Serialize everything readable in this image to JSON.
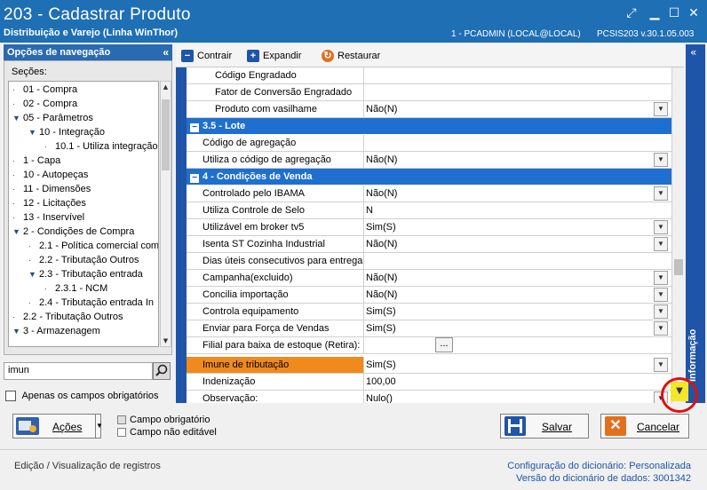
{
  "window": {
    "title": "203 - Cadastrar  Produto",
    "subtitle": "Distribuição e Varejo (Linha WinThor)",
    "user_info": "1 - PCADMIN (LOCAL@LOCAL)",
    "version_info": "PCSIS203  v.30.1.05.003"
  },
  "nav": {
    "header": "Opções de navegação",
    "sections_label": "Seções:",
    "items": [
      {
        "label": "01 - Compra",
        "level": 0,
        "toggle": ""
      },
      {
        "label": "02 - Compra",
        "level": 0,
        "toggle": ""
      },
      {
        "label": "05 - Parâmetros",
        "level": 0,
        "toggle": "v"
      },
      {
        "label": "10 - Integração",
        "level": 1,
        "toggle": "v"
      },
      {
        "label": "10.1 - Utiliza integração",
        "level": 2,
        "toggle": ""
      },
      {
        "label": "1 - Capa",
        "level": 0,
        "toggle": ""
      },
      {
        "label": "10 - Autopeças",
        "level": 0,
        "toggle": ""
      },
      {
        "label": "11 - Dimensões",
        "level": 0,
        "toggle": ""
      },
      {
        "label": "12 - Licitações",
        "level": 0,
        "toggle": ""
      },
      {
        "label": "13 - Inservível",
        "level": 0,
        "toggle": ""
      },
      {
        "label": "2 - Condições de Compra",
        "level": 0,
        "toggle": "v"
      },
      {
        "label": "2.1 - Política comercial com",
        "level": 1,
        "toggle": ""
      },
      {
        "label": "2.2 - Tributação Outros",
        "level": 1,
        "toggle": ""
      },
      {
        "label": "2.3 - Tributação entrada",
        "level": 1,
        "toggle": "v"
      },
      {
        "label": "2.3.1 - NCM",
        "level": 2,
        "toggle": ""
      },
      {
        "label": "2.4 - Tributação entrada In",
        "level": 1,
        "toggle": ""
      },
      {
        "label": "2.2 - Tributação Outros",
        "level": 0,
        "toggle": ""
      },
      {
        "label": "3 - Armazenagem",
        "level": 0,
        "toggle": "v"
      }
    ],
    "search_value": "imun",
    "only_required_label": "Apenas os campos obrigatórios"
  },
  "toolbar": {
    "collapse_label": "Contrair",
    "expand_label": "Expandir",
    "restore_label": "Restaurar"
  },
  "grid": {
    "rows": [
      {
        "kind": "field",
        "label": "Código Engradado",
        "value": "",
        "dropdown": false,
        "indent": true
      },
      {
        "kind": "field",
        "label": "Fator de Conversão Engradado",
        "value": "",
        "dropdown": false,
        "indent": true
      },
      {
        "kind": "field",
        "label": "Produto com vasilhame",
        "value": "Não(N)",
        "dropdown": true,
        "indent": true
      },
      {
        "kind": "section",
        "label": "3.5 - Lote"
      },
      {
        "kind": "field",
        "label": "Código de agregação",
        "value": "",
        "dropdown": false
      },
      {
        "kind": "field",
        "label": "Utiliza o código de agregação",
        "value": "Não(N)",
        "dropdown": true
      },
      {
        "kind": "section",
        "label": "4 - Condições de Venda"
      },
      {
        "kind": "field",
        "label": "Controlado pelo IBAMA",
        "value": "Não(N)",
        "dropdown": true
      },
      {
        "kind": "field",
        "label": "Utiliza Controle de Selo",
        "value": "N",
        "dropdown": false
      },
      {
        "kind": "field",
        "label": "Utilizável em broker tv5",
        "value": "Sim(S)",
        "dropdown": true
      },
      {
        "kind": "field",
        "label": "Isenta ST Cozinha Industrial",
        "value": "Não(N)",
        "dropdown": true
      },
      {
        "kind": "field",
        "label": "Dias úteis consecutivos para entrega",
        "value": "",
        "dropdown": false
      },
      {
        "kind": "field",
        "label": "Campanha(excluido)",
        "value": "Não(N)",
        "dropdown": true
      },
      {
        "kind": "field",
        "label": "Concilia importação",
        "value": "Não(N)",
        "dropdown": true
      },
      {
        "kind": "field",
        "label": "Controla equipamento",
        "value": "Sim(S)",
        "dropdown": true
      },
      {
        "kind": "field",
        "label": "Enviar para Força de Vendas",
        "value": "Sim(S)",
        "dropdown": true
      },
      {
        "kind": "field",
        "label": "Filial para baixa de estoque (Retira):",
        "value": "",
        "dropdown": false,
        "ellipsis": true
      },
      {
        "kind": "field",
        "label": "Imune de tributação",
        "value": "Sim(S)",
        "dropdown": true,
        "selected": true
      },
      {
        "kind": "field",
        "label": "Indenização",
        "value": "100,00",
        "dropdown": false
      },
      {
        "kind": "field",
        "label": "Observação:",
        "value": "Nulo()",
        "dropdown": true
      }
    ],
    "ellipsis_label": "..."
  },
  "side_panel": {
    "vertical_label": "Informação"
  },
  "bottom": {
    "actions_label": "Ações",
    "legend_required": "Campo obrigatório",
    "legend_readonly": "Campo não editável",
    "save_label": "Salvar",
    "cancel_label": "Cancelar",
    "status_left": "Edição / Visualização de registros",
    "dict_config_label": "Configuração do dicionário:",
    "dict_config_value": "Personalizada",
    "dict_version_label": "Versão do dicionário de dados:",
    "dict_version_value": "3001342"
  },
  "colors": {
    "titlebar": "#1f6fb5",
    "section": "#1f6fd0",
    "selected": "#f08a1c",
    "highlight": "#e01010"
  }
}
